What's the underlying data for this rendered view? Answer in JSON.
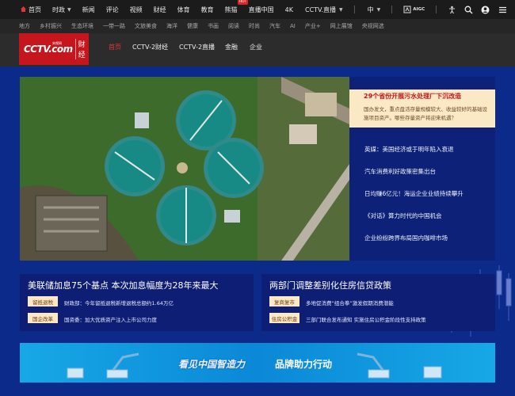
{
  "topbar": {
    "nav": [
      {
        "label": "首页",
        "caret": false
      },
      {
        "label": "时政",
        "caret": true
      },
      {
        "label": "新闻",
        "caret": false
      },
      {
        "label": "评论",
        "caret": false
      },
      {
        "label": "视频",
        "caret": false
      },
      {
        "label": "财经",
        "caret": false
      },
      {
        "label": "体育",
        "caret": false
      },
      {
        "label": "教育",
        "caret": false
      },
      {
        "label": "熊猫",
        "caret": false,
        "badge": "HOT"
      },
      {
        "label": "直播中国",
        "caret": false
      },
      {
        "label": "4K",
        "caret": false
      }
    ],
    "site_select": "CCTV.直播",
    "lang_select": "中",
    "aigc_label": "AIGC",
    "icons": [
      "accessibility-icon",
      "search-icon",
      "user-icon",
      "menu-icon"
    ]
  },
  "subbar": [
    "地方",
    "乡村振兴",
    "生态环境",
    "一带一路",
    "文旅美食",
    "海洋",
    "健康",
    "书画",
    "阅读",
    "时尚",
    "汽车",
    "AI",
    "产业+",
    "网上展馆",
    "央视网选"
  ],
  "header": {
    "logo_text": "CCTV.com",
    "logo_small": "央视网",
    "logo_channel": "财经",
    "channels": [
      "首页",
      "CCTV-2财经",
      "CCTV-2直播",
      "金融",
      "企业"
    ],
    "active_channel": "首页"
  },
  "hero": {
    "image_desc_icon": "sewage-plant-photo",
    "feature": {
      "title": "29个省份开展污水处理厂下沉改造",
      "desc": "国办发文，重点盘活存量规模较大、收益较好的基础设施项目资产。哪些存量资产将迎来机遇？"
    },
    "list": [
      "英媒：美国经济或于明年陷入衰退",
      "汽车消费利好政策密集出台",
      "日均赚6亿元！海运企业业绩持续攀升",
      "《对话》算力时代的中国机会",
      "企业纷纷跨界布局国内咖啡市场"
    ]
  },
  "cards": [
    {
      "title": "美联储加息75个基点 本次加息幅度为28年来最大",
      "rows": [
        {
          "tag": "留抵退税",
          "text": "财政部：今年留抵退税新增退税总额约1.64万亿"
        },
        {
          "tag": "国企改革",
          "text": "国资委：加大优质资产注入上市公司力度"
        }
      ]
    },
    {
      "title": "两部门调整差别化住房信贷政策",
      "rows": [
        {
          "tag": "复商复市",
          "text": "多地促消费“组合拳”激发假期消费潜能"
        },
        {
          "tag": "住房公积金",
          "text": "三部门联合发布通知 实施住房公积金阶段性支持政策"
        }
      ]
    }
  ],
  "banner": {
    "text_left": "看见中国智造力",
    "text_right": "品牌助力行动"
  },
  "colors": {
    "brand_red": "#c6161d",
    "page_bg": "#0b2a8a",
    "tag_bg": "#fce8c4",
    "feature_bg": "#fbe8c5"
  }
}
